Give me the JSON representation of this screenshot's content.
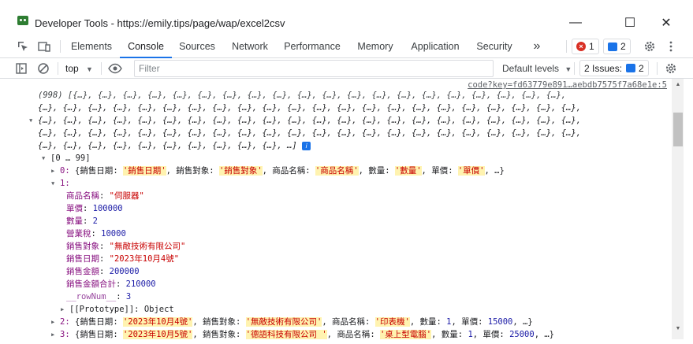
{
  "window": {
    "title": "Developer Tools - https://emily.tips/page/wap/excel2csv",
    "minimize": "—",
    "maximize": "☐",
    "close": "✕"
  },
  "toolbar": {
    "tabs": [
      "Elements",
      "Console",
      "Sources",
      "Network",
      "Performance",
      "Memory",
      "Application",
      "Security"
    ],
    "active_tab": "Console",
    "more": "»",
    "error_count": "1",
    "message_count": "2"
  },
  "filterbar": {
    "context": "top",
    "filter_placeholder": "Filter",
    "levels": "Default levels",
    "issues_label": "2 Issues:",
    "issues_count": "2"
  },
  "console": {
    "source_link": "code?key=fd63779e891…aebdb7575f7a68e1e:5",
    "summary_count": "(998)",
    "summary_line1": " [{…}, {…}, {…}, {…}, {…}, {…}, {…}, {…}, {…}, {…}, {…}, {…}, {…}, {…}, {…}, {…}, {…}, {…}, {…}, {…},",
    "summary_line2": "{…}, {…}, {…}, {…}, {…}, {…}, {…}, {…}, {…}, {…}, {…}, {…}, {…}, {…}, {…}, {…}, {…}, {…}, {…}, {…}, {…}, {…},",
    "summary_line3": "{…}, {…}, {…}, {…}, {…}, {…}, {…}, {…}, {…}, {…}, {…}, {…}, {…}, {…}, {…}, {…}, {…}, {…}, {…}, {…}, {…}, {…},",
    "summary_line4": "{…}, {…}, {…}, {…}, {…}, {…}, {…}, {…}, {…}, {…}, {…}, {…}, {…}, {…}, {…}, {…}, {…}, {…}, {…}, {…}, {…}, {…},",
    "summary_line5": "{…}, {…}, {…}, {…}, {…}, {…}, {…}, {…}, {…}, {…}, …]",
    "range": "[0 … 99]",
    "row0": {
      "index": "0:",
      "k1": "銷售日期",
      "v1": "'銷售日期'",
      "k2": "銷售對象",
      "v2": "'銷售對象'",
      "k3": "商品名稱",
      "v3": "'商品名稱'",
      "k4": "數量",
      "v4": "'數量'",
      "k5": "單價",
      "v5": "'單價'",
      "tail": ", …}"
    },
    "row1": {
      "index": "1:",
      "props": [
        {
          "key": "商品名稱",
          "value": "\"伺服器\"",
          "type": "str"
        },
        {
          "key": "單價",
          "value": "100000",
          "type": "num"
        },
        {
          "key": "數量",
          "value": "2",
          "type": "num"
        },
        {
          "key": "營業稅",
          "value": "10000",
          "type": "num"
        },
        {
          "key": "銷售對象",
          "value": "\"無敵技術有限公司\"",
          "type": "str"
        },
        {
          "key": "銷售日期",
          "value": "\"2023年10月4號\"",
          "type": "str"
        },
        {
          "key": "銷售金額",
          "value": "200000",
          "type": "num"
        },
        {
          "key": "銷售金額合計",
          "value": "210000",
          "type": "num"
        },
        {
          "key": "__rowNum__",
          "value": "3",
          "type": "num"
        }
      ],
      "prototype": "[[Prototype]]: Object"
    },
    "row2": {
      "index": "2:",
      "k1": "銷售日期",
      "v1": "'2023年10月4號'",
      "k2": "銷售對象",
      "v2": "'無敵技術有限公司'",
      "k3": "商品名稱",
      "v3": "'印表機'",
      "k4": "數量",
      "v4": "1",
      "k5": "單價",
      "v5": "15000",
      "tail": ", …}"
    },
    "row3": {
      "index": "3:",
      "k1": "銷售日期",
      "v1": "'2023年10月5號'",
      "k2": "銷售對象",
      "v2": "'德語科技有限公司 '",
      "k3": "商品名稱",
      "v3": "'桌上型電腦'",
      "k4": "數量",
      "v4": "1",
      "k5": "單價",
      "v5": "25000",
      "tail": ", …}"
    }
  }
}
